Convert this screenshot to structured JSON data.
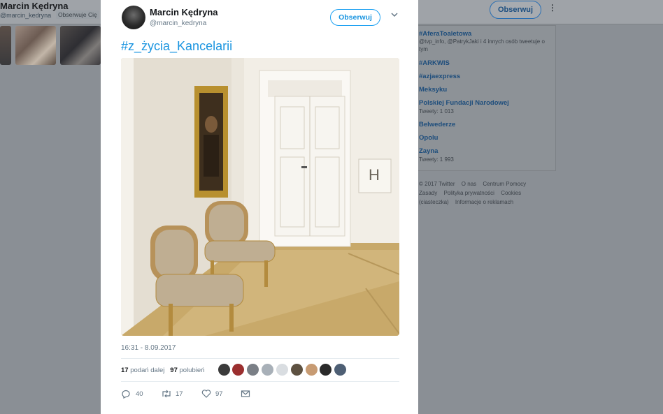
{
  "background": {
    "profile_name": "Marcin Kędryna",
    "profile_handle": "@marcin_kedryna",
    "follows_you": "Obserwuje Cię",
    "follow_label": "Obserwuj",
    "more_icon": "vertical-dots-icon",
    "trends": [
      {
        "tag": "#AferaToaletowa",
        "sub": "@tvp_info, @PatrykJaki i 4 innych osób tweetuje o tym"
      },
      {
        "tag": "#ARKWIS",
        "sub": ""
      },
      {
        "tag": "#azjaexpress",
        "sub": ""
      },
      {
        "tag": "Meksyku",
        "sub": ""
      },
      {
        "tag": "Polskiej Fundacji Narodowej",
        "sub": "Tweety: 1 013"
      },
      {
        "tag": "Belwederze",
        "sub": ""
      },
      {
        "tag": "Opolu",
        "sub": ""
      },
      {
        "tag": "Zayna",
        "sub": "Tweety: 1 993"
      }
    ],
    "footer": [
      "© 2017 Twitter",
      "O nas",
      "Centrum Pomocy",
      "Zasady",
      "Polityka prywatności",
      "Cookies (ciasteczka)",
      "Informacje o reklamach"
    ]
  },
  "tweet": {
    "author_name": "Marcin Kędryna",
    "author_handle": "@marcin_kedryna",
    "follow_label": "Obserwuj",
    "text": "#z_życia_Kancelarii",
    "door_sign": "H",
    "timestamp": "16:31 - 8.09.2017",
    "retweets_count": "17",
    "retweets_label": "podań dalej",
    "likes_count": "97",
    "likes_label": "polubień",
    "reply_count": "40",
    "retweet_action_count": "17",
    "like_action_count": "97"
  },
  "colors": {
    "accent": "#1da1f2",
    "link": "#1b95e0",
    "text": "#14171a",
    "muted": "#657786",
    "overlay": "#8a8f95"
  }
}
